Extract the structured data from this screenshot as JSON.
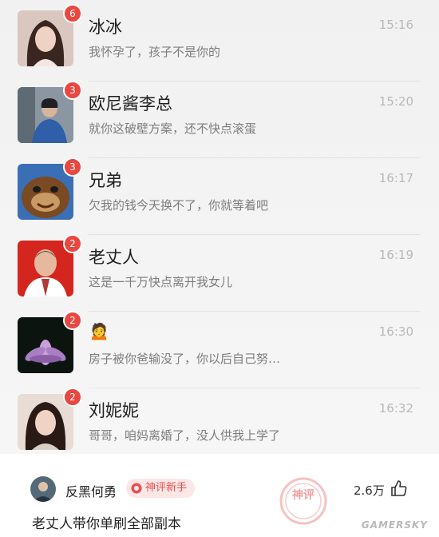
{
  "chats": [
    {
      "name": "冰冰",
      "time": "15:16",
      "preview": "我怀孕了，孩子不是你的",
      "unread": "6",
      "avatar": "woman-portrait-avatar"
    },
    {
      "name": "欧尼酱李总",
      "time": "15:20",
      "preview": "就你这破壁方案，还不快点滚蛋",
      "unread": "3",
      "avatar": "businessman-avatar"
    },
    {
      "name": "兄弟",
      "time": "16:17",
      "preview": "欠我的钱今天换不了，你就等着吧",
      "unread": "3",
      "avatar": "cartoon-bear-avatar"
    },
    {
      "name": "老丈人",
      "time": "16:19",
      "preview": "这是一千万快点离开我女儿",
      "unread": "2",
      "avatar": "older-man-avatar"
    },
    {
      "name": "🙍",
      "time": "16:30",
      "preview": "房子被你爸输没了，你以后自己努…",
      "unread": "2",
      "avatar": "lotus-flower-avatar"
    },
    {
      "name": "刘妮妮",
      "time": "16:32",
      "preview": "哥哥，咱妈离婚了，没人供我上学了",
      "unread": "2",
      "avatar": "girl-portrait-avatar"
    }
  ],
  "comment": {
    "username": "反黑何勇",
    "badge": "神评新手",
    "text": "老丈人带你单刷全部副本",
    "likes": "2.6万",
    "stamp_text": "神评"
  },
  "watermark": "GAMERSKY",
  "colors": {
    "badge_red": "#e9473f",
    "accent_red": "#e25252"
  }
}
